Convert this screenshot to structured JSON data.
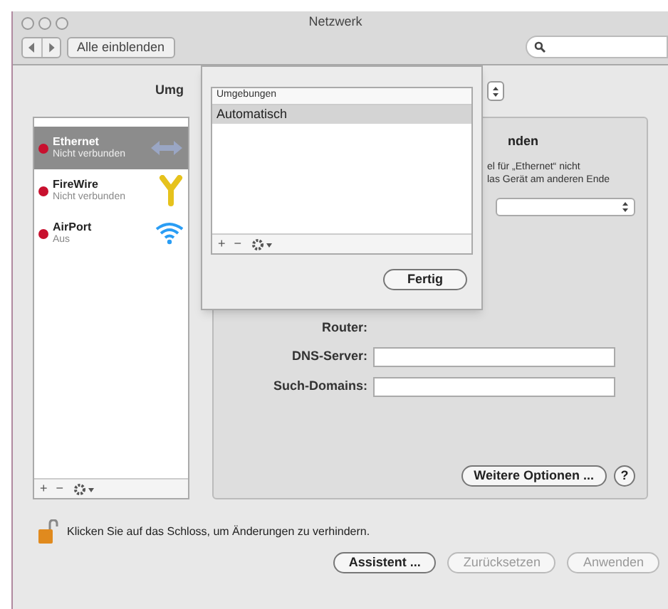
{
  "window": {
    "title": "Netzwerk"
  },
  "toolbar": {
    "show_all": "Alle einblenden"
  },
  "location": {
    "label": "Umg"
  },
  "services": [
    {
      "name": "Ethernet",
      "status": "Nicht verbunden",
      "selected": true,
      "kind": "ethernet"
    },
    {
      "name": "FireWire",
      "status": "Nicht verbunden",
      "selected": false,
      "kind": "firewire"
    },
    {
      "name": "AirPort",
      "status": "Aus",
      "selected": false,
      "kind": "wifi"
    }
  ],
  "list_buttons": [
    "+",
    "−"
  ],
  "status": {
    "title": "nden",
    "lines": [
      "el für „Ethernet“ nicht",
      "las Gerät am anderen Ende"
    ]
  },
  "fields": [
    {
      "label": "Router:",
      "kind": "text"
    },
    {
      "label": "DNS-Server:",
      "kind": "input"
    },
    {
      "label": "Such-Domains:",
      "kind": "input"
    }
  ],
  "more_options": "Weitere Optionen ...",
  "help": "?",
  "lock_text": "Klicken Sie auf das Schloss, um Änderungen zu verhindern.",
  "buttons": [
    {
      "label": "Assistent ...",
      "disabled": false
    },
    {
      "label": "Zurücksetzen",
      "disabled": true
    },
    {
      "label": "Anwenden",
      "disabled": true
    }
  ],
  "sheet": {
    "column": "Umgebungen",
    "items": [
      {
        "label": "Automatisch",
        "selected": true
      }
    ],
    "buttons": [
      "+",
      "−"
    ],
    "done": "Fertig"
  }
}
